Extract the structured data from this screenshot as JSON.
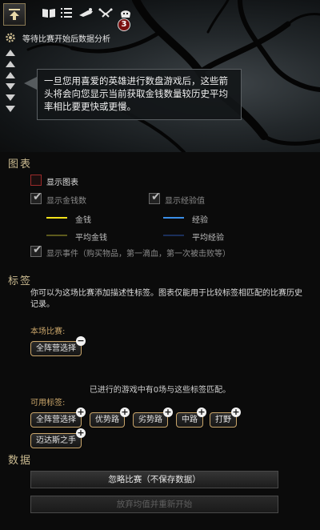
{
  "toolbar": {
    "badge_count": "3",
    "icons": [
      "home-arrow-icon",
      "book-icon",
      "list-icon",
      "courier-icon",
      "swords-icon",
      "hero-head-icon"
    ]
  },
  "status": {
    "text": "等待比赛开始后数据分析"
  },
  "tooltip": {
    "text": "一旦您用喜爱的英雄进行数盘游戏后，这些箭头将会向您显示当前获取金钱数量较历史平均率相比要更快或更慢。"
  },
  "chart_section": {
    "title": "图表",
    "show_chart": "显示图表",
    "show_gold": "显示金钱数",
    "show_xp": "显示经验值",
    "gold": "金钱",
    "avg_gold": "平均金钱",
    "xp": "经验",
    "avg_xp": "平均经验",
    "show_events": "显示事件（购买物品，第一滴血，第一次被击败等）",
    "colors": {
      "gold": "#f2e21a",
      "avg_gold": "#5d5a1c",
      "xp": "#3a8ee8",
      "avg_xp": "#1b2f5a"
    }
  },
  "tags_section": {
    "title": "标签",
    "description": "你可以为这场比赛添加描述性标签。图表仅能用于比较标签相匹配的比赛历史记录。",
    "this_match_label": "本场比赛:",
    "current_tags": [
      "全阵营选择"
    ],
    "match_note": "已进行的游戏中有0场与这些标签匹配。",
    "available_label": "可用标签:",
    "available_tags": [
      "全阵营选择",
      "优势路",
      "劣势路",
      "中路",
      "打野",
      "迈达斯之手"
    ]
  },
  "data_section": {
    "title": "数据",
    "ignore_button": "忽略比赛（不保存数据）",
    "restart_button": "放弃均值并重新开始"
  }
}
